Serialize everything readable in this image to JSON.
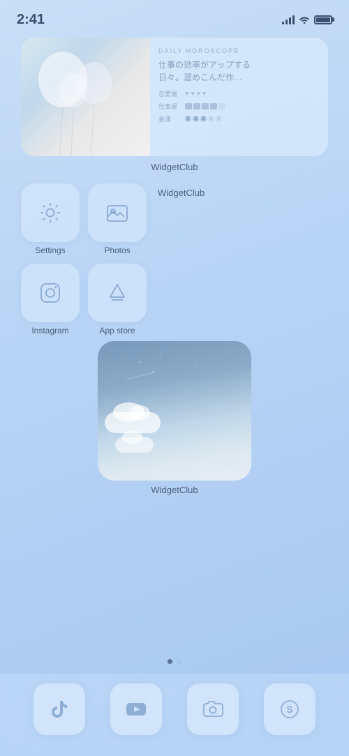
{
  "statusBar": {
    "time": "2:41",
    "battery": "full"
  },
  "widget1": {
    "label": "WidgetClub",
    "horoscope": {
      "title": "DAILY HOROSCOPE",
      "body": "仕事の効率がアップする\n日々。溜めこんだ作…",
      "rows": [
        {
          "label": "恋愛運",
          "type": "hearts",
          "filled": 4
        },
        {
          "label": "仕事運",
          "type": "books",
          "filled": 4
        },
        {
          "label": "金運",
          "type": "coins",
          "filled": 3
        }
      ]
    }
  },
  "apps": [
    {
      "id": "settings",
      "label": "Settings",
      "icon": "gear"
    },
    {
      "id": "photos",
      "label": "Photos",
      "icon": "photo"
    },
    {
      "id": "instagram",
      "label": "Instagram",
      "icon": "instagram"
    },
    {
      "id": "appstore",
      "label": "App store",
      "icon": "appstore"
    }
  ],
  "widget2": {
    "label": "WidgetClub"
  },
  "widget3": {
    "label": "WidgetClub"
  },
  "dock": [
    {
      "id": "tiktok",
      "icon": "tiktok"
    },
    {
      "id": "youtube",
      "icon": "youtube"
    },
    {
      "id": "camera",
      "icon": "camera"
    },
    {
      "id": "safari",
      "icon": "safari"
    }
  ]
}
